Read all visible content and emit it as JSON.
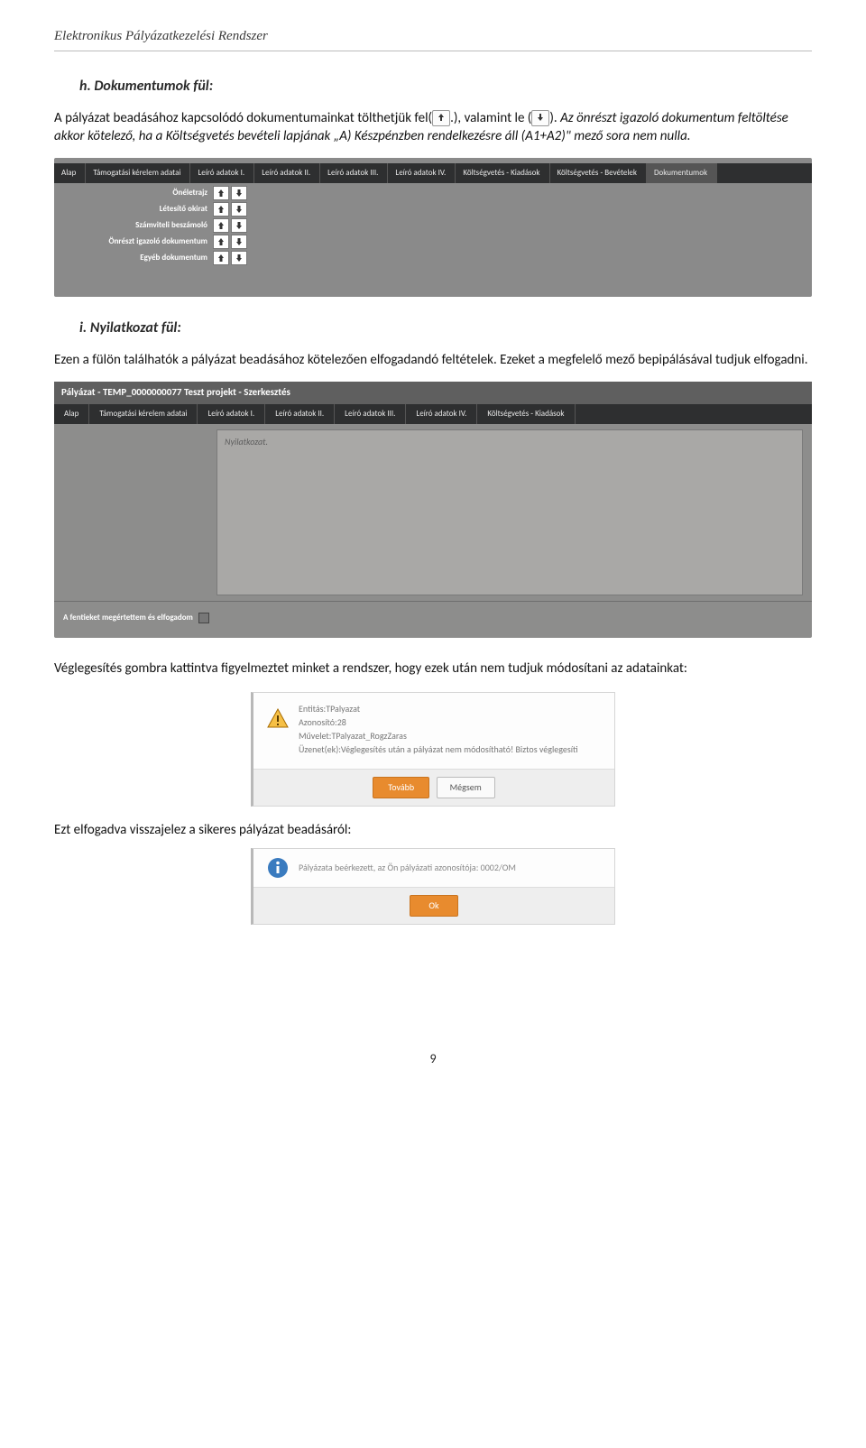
{
  "document_title": "Elektronikus Pályázatkezelési Rendszer",
  "section_h": {
    "title": "h. Dokumentumok fül:",
    "para1a": "A pályázat beadásához kapcsolódó dokumentumainkat tölthetjük fel(",
    "para1b": ".), valamint le (",
    "para1c": ").",
    "para2": "Az önrészt igazoló dokumentum feltöltése akkor kötelező, ha a Költségvetés bevételi lapjának „A) Készpénzben rendelkezésre áll (A1+A2)\" mező sora nem nulla."
  },
  "shot1": {
    "tabs": [
      "Alap",
      "Támogatási kérelem adatai",
      "Leíró adatok I.",
      "Leíró adatok II.",
      "Leíró adatok III.",
      "Leíró adatok IV.",
      "Költségvetés - Kiadások",
      "Költségvetés - Bevételek",
      "Dokumentumok"
    ],
    "rows": [
      "Önéletrajz",
      "Létesítő okirat",
      "Számviteli beszámoló",
      "Önrészt igazoló dokumentum",
      "Egyéb dokumentum"
    ]
  },
  "section_i": {
    "title": "i. Nyilatkozat fül:",
    "para": "Ezen a fülön találhatók a pályázat beadásához kötelezően elfogadandó feltételek. Ezeket a megfelelő mező bepipálásával tudjuk elfogadni."
  },
  "shot2": {
    "title": "Pályázat - TEMP_0000000077 Teszt projekt - Szerkesztés",
    "tabs": [
      "Alap",
      "Támogatási kérelem adatai",
      "Leíró adatok I.",
      "Leíró adatok II.",
      "Leíró adatok III.",
      "Leíró adatok IV.",
      "Költségvetés - Kiadások"
    ],
    "placeholder": "Nyilatkozat.",
    "accept": "A fentieket megértettem és elfogadom"
  },
  "para_after_shot2": "Véglegesítés gombra kattintva figyelmeztet minket a rendszer, hogy ezek után nem tudjuk módosítani az adatainkat:",
  "dialog1": {
    "line1": "Entitás:TPalyazat",
    "line2": "Azonosító:28",
    "line3": "Művelet:TPalyazat_RogzZaras",
    "line4": "Üzenet(ek):Véglegesítés után a pályázat nem módosítható! Biztos véglegesíti",
    "btn_ok": "Tovább",
    "btn_cancel": "Mégsem"
  },
  "para_after_dialog1": "Ezt elfogadva visszajelez a sikeres pályázat beadásáról:",
  "dialog2": {
    "text": "Pályázata beérkezett, az Ön pályázati azonosítója: 0002/OM",
    "btn_ok": "Ok"
  },
  "page_number": "9"
}
